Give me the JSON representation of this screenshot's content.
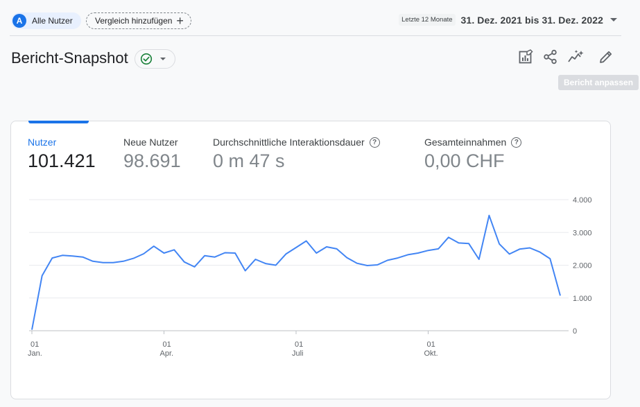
{
  "segment": {
    "avatar_letter": "A",
    "label": "Alle Nutzer"
  },
  "compare": {
    "label": "Vergleich hinzufügen",
    "icon": "plus-icon"
  },
  "date_range": {
    "preset": "Letzte 12 Monate",
    "value": "31. Dez. 2021 bis 31. Dez. 2022"
  },
  "page": {
    "title": "Bericht-Snapshot",
    "status_icon": "check-circle-icon",
    "status_color": "#188038"
  },
  "toolbar": {
    "icons": [
      "chart-edit-icon",
      "share-icon",
      "insights-icon",
      "pencil-icon"
    ],
    "tooltip": "Bericht anpassen"
  },
  "metrics": [
    {
      "label": "Nutzer",
      "value": "101.421",
      "active": true
    },
    {
      "label": "Neue Nutzer",
      "value": "98.691",
      "active": false
    },
    {
      "label": "Durchschnittliche Interaktionsdauer",
      "value": "0 m 47 s",
      "active": false,
      "help": "?"
    },
    {
      "label": "Gesamteinnahmen",
      "value": "0,00 CHF",
      "active": false,
      "help": "?"
    }
  ],
  "colors": {
    "accent": "#1a73e8",
    "line": "#4285f4"
  },
  "chart_data": {
    "type": "line",
    "series": [
      {
        "values": [
          30,
          1680,
          2220,
          2300,
          2280,
          2250,
          2120,
          2080,
          2080,
          2120,
          2210,
          2350,
          2580,
          2370,
          2470,
          2100,
          1950,
          2290,
          2250,
          2380,
          2370,
          1830,
          2180,
          2050,
          2000,
          2340,
          2540,
          2740,
          2370,
          2560,
          2500,
          2230,
          2060,
          1990,
          2010,
          2150,
          2220,
          2320,
          2370,
          2450,
          2500,
          2850,
          2680,
          2660,
          2180,
          3520,
          2650,
          2340,
          2490,
          2530,
          2400,
          2200,
          1070
        ]
      }
    ],
    "y_ticks": [
      "4.000",
      "3.000",
      "2.000",
      "1.000",
      "0"
    ],
    "y_tick_values": [
      4000,
      3000,
      2000,
      1000,
      0
    ],
    "x_ticks": [
      {
        "day": "01",
        "month": "Jan.",
        "index": 0
      },
      {
        "day": "01",
        "month": "Apr.",
        "index": 13
      },
      {
        "day": "01",
        "month": "Juli",
        "index": 26
      },
      {
        "day": "01",
        "month": "Okt.",
        "index": 39
      }
    ],
    "ylim": [
      0,
      4000
    ],
    "grid": true
  }
}
